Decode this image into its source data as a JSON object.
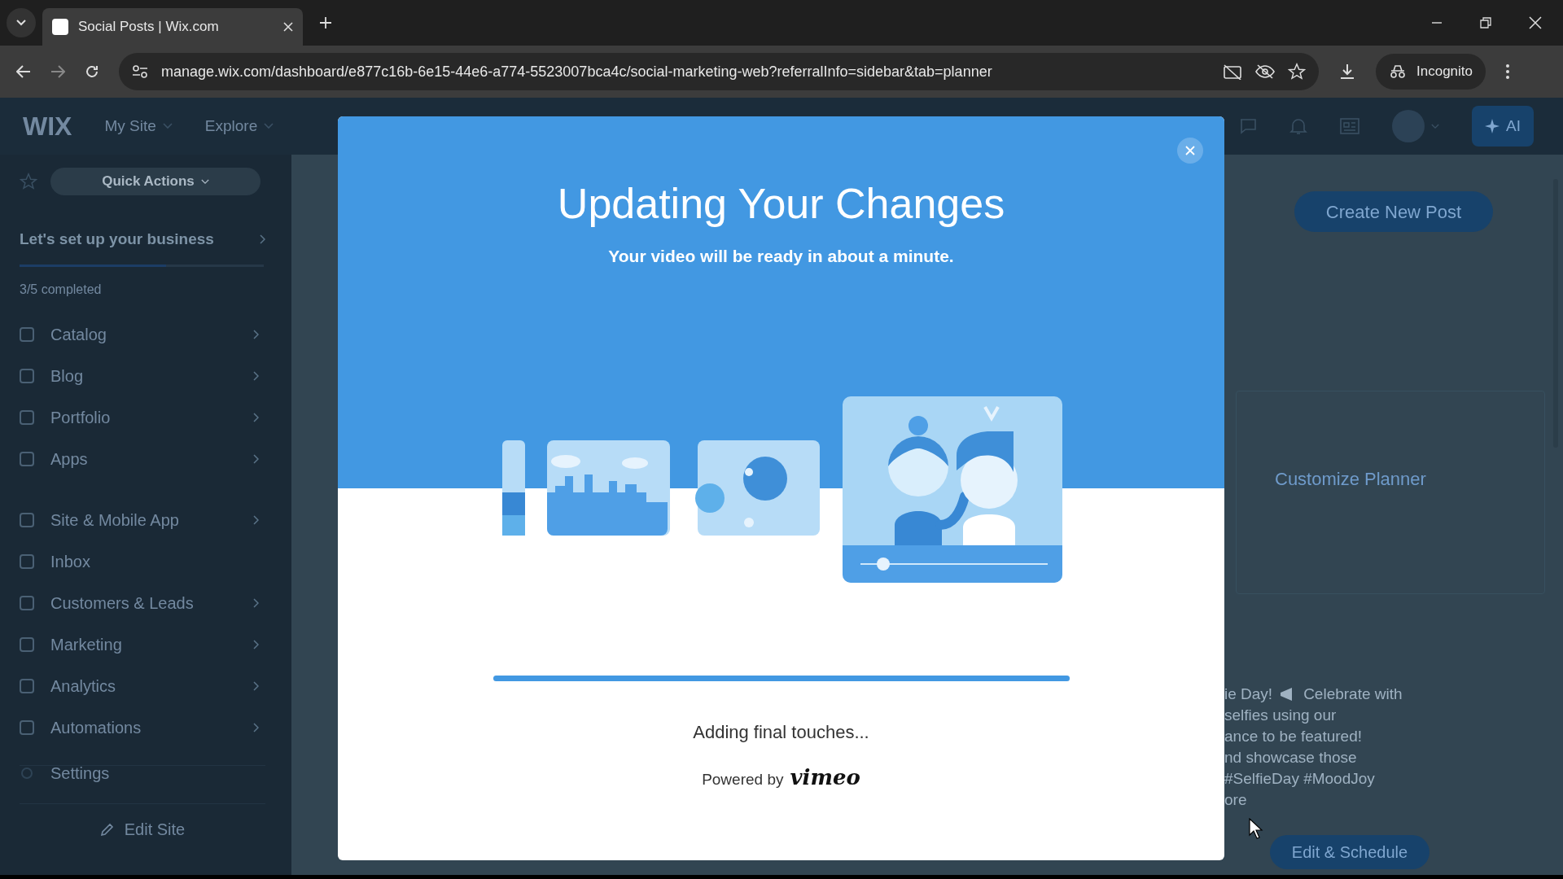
{
  "browser": {
    "tab_title": "Social Posts | Wix.com",
    "url": "manage.wix.com/dashboard/e877c16b-6e15-44e6-a774-5523007bca4c/social-marketing-web?referralInfo=sidebar&tab=planner",
    "profile_label": "Incognito"
  },
  "topbar": {
    "logo": "WIX",
    "menus": [
      "My Site",
      "Explore"
    ],
    "ai_button": "AI"
  },
  "sidebar": {
    "quick_actions": "Quick Actions",
    "setup": {
      "title": "Let's set up your business",
      "level": 0.6,
      "progress": "3/5 completed"
    },
    "groups": [
      [
        {
          "label": "Catalog",
          "chevron": true
        },
        {
          "label": "Blog",
          "chevron": true
        },
        {
          "label": "Portfolio",
          "chevron": true
        },
        {
          "label": "Apps",
          "chevron": true
        }
      ],
      [
        {
          "label": "Site & Mobile App",
          "chevron": true
        },
        {
          "label": "Inbox",
          "chevron": false
        },
        {
          "label": "Customers & Leads",
          "chevron": true
        },
        {
          "label": "Marketing",
          "chevron": true
        },
        {
          "label": "Analytics",
          "chevron": true
        },
        {
          "label": "Automations",
          "chevron": true
        }
      ]
    ],
    "settings": "Settings",
    "edit_site": "Edit Site"
  },
  "background": {
    "create_button": "Create New Post",
    "customize": "Customize Planner",
    "post_first_line": [
      "ie Day!",
      "Celebrate with"
    ],
    "post_lines": [
      "selfies using our",
      "ance to be featured!",
      "nd showcase those",
      "#SelfieDay #MoodJoy",
      "ore"
    ],
    "edit_button": "Edit & Schedule"
  },
  "modal": {
    "title": "Updating Your Changes",
    "subtitle": "Your video will be ready in about a minute.",
    "progress": {
      "level": 1
    },
    "status": "Adding final touches...",
    "powered_by": "Powered by",
    "brand": "vimeo"
  }
}
